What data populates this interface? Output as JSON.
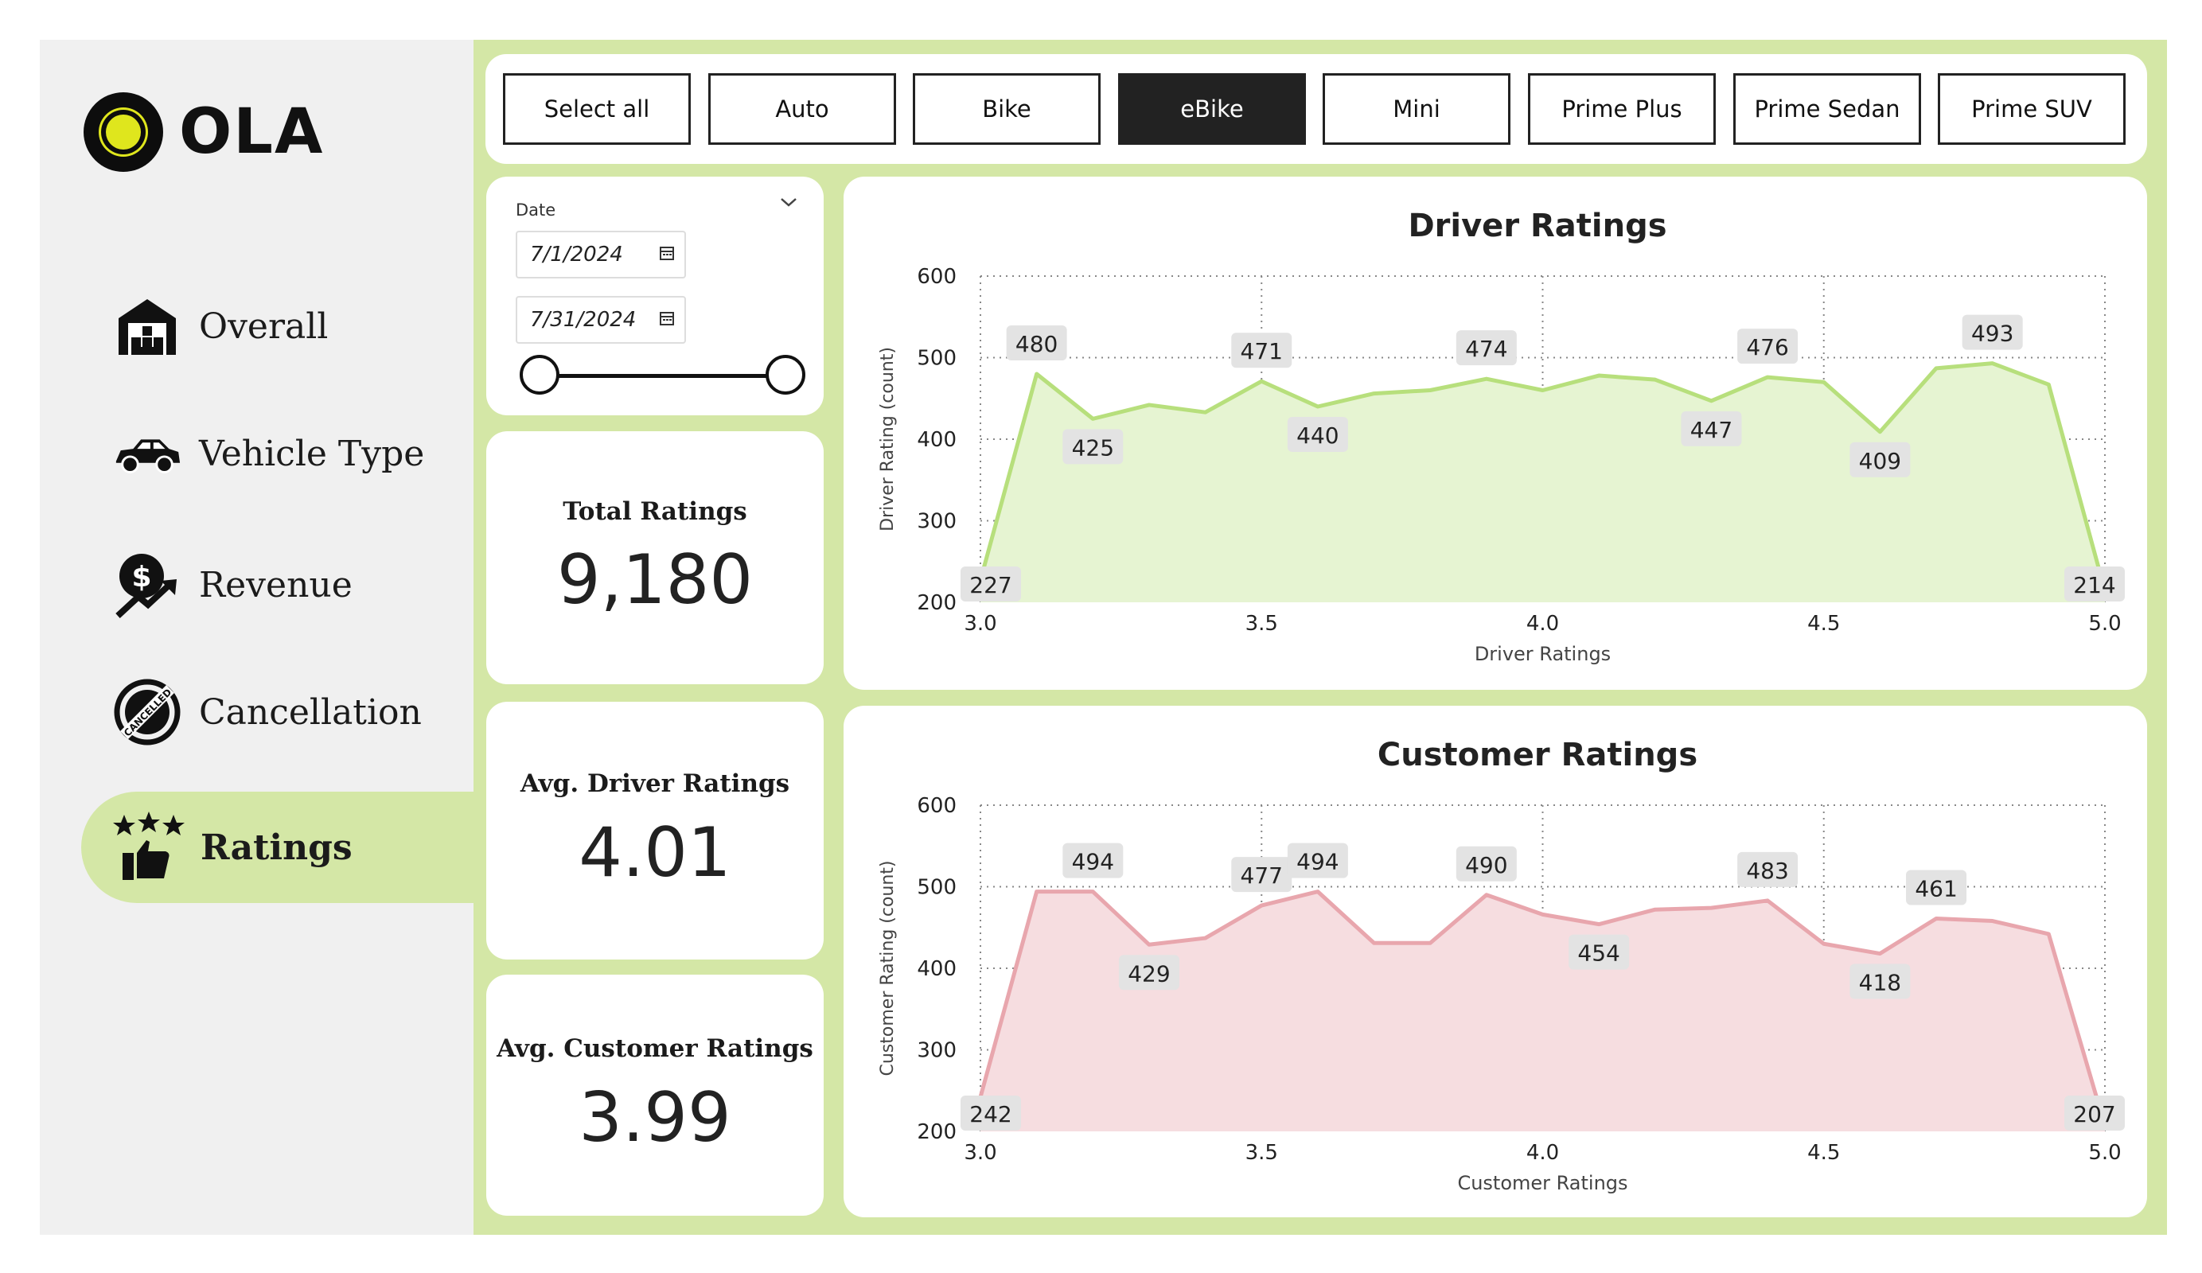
{
  "logo": {
    "text": "OLA"
  },
  "sidebar": {
    "items": [
      {
        "label": "Overall",
        "icon": "warehouse-icon"
      },
      {
        "label": "Vehicle Type",
        "icon": "car-icon"
      },
      {
        "label": "Revenue",
        "icon": "revenue-icon"
      },
      {
        "label": "Cancellation",
        "icon": "cancelled-stamp-icon"
      },
      {
        "label": "Ratings",
        "icon": "stars-thumbs-up-icon",
        "active": true
      }
    ]
  },
  "filters": {
    "vehicle_types": [
      {
        "label": "Select all",
        "selected": false
      },
      {
        "label": "Auto",
        "selected": false
      },
      {
        "label": "Bike",
        "selected": false
      },
      {
        "label": "eBike",
        "selected": true
      },
      {
        "label": "Mini",
        "selected": false
      },
      {
        "label": "Prime Plus",
        "selected": false
      },
      {
        "label": "Prime Sedan",
        "selected": false
      },
      {
        "label": "Prime SUV",
        "selected": false
      }
    ],
    "date": {
      "label": "Date",
      "start": "7/1/2024",
      "end": "7/31/2024"
    }
  },
  "cards": {
    "total_ratings": {
      "title": "Total Ratings",
      "value": "9,180"
    },
    "avg_driver": {
      "title": "Avg. Driver Ratings",
      "value": "4.01"
    },
    "avg_customer": {
      "title": "Avg. Customer Ratings",
      "value": "3.99"
    }
  },
  "colors": {
    "accent": "#d4e7a6",
    "driver_line": "#b7df7c",
    "driver_fill": "#e6f4d2",
    "customer_line": "#e8a6ad",
    "customer_fill": "#f6dde0"
  },
  "chart_data": [
    {
      "type": "area",
      "title": "Driver Ratings",
      "xlabel": "Driver Ratings",
      "ylabel": "Driver Rating (count)",
      "xlim": [
        3.0,
        5.0
      ],
      "ylim": [
        200,
        600
      ],
      "xticks": [
        "3.0",
        "3.5",
        "4.0",
        "4.5",
        "5.0"
      ],
      "yticks": [
        "200",
        "300",
        "400",
        "500",
        "600"
      ],
      "grid": true,
      "x": [
        3.0,
        3.1,
        3.2,
        3.3,
        3.4,
        3.5,
        3.6,
        3.7,
        3.8,
        3.9,
        4.0,
        4.1,
        4.2,
        4.3,
        4.4,
        4.5,
        4.6,
        4.7,
        4.8,
        4.9,
        5.0
      ],
      "y": [
        227,
        480,
        425,
        442,
        433,
        471,
        440,
        456,
        460,
        474,
        460,
        478,
        473,
        447,
        476,
        470,
        409,
        487,
        493,
        467,
        214
      ],
      "labels": [
        {
          "x": 3.0,
          "y": 227,
          "text": "227"
        },
        {
          "x": 3.1,
          "y": 480,
          "text": "480"
        },
        {
          "x": 3.2,
          "y": 425,
          "text": "425"
        },
        {
          "x": 3.5,
          "y": 471,
          "text": "471"
        },
        {
          "x": 3.6,
          "y": 440,
          "text": "440"
        },
        {
          "x": 3.9,
          "y": 474,
          "text": "474"
        },
        {
          "x": 4.3,
          "y": 447,
          "text": "447"
        },
        {
          "x": 4.4,
          "y": 476,
          "text": "476"
        },
        {
          "x": 4.6,
          "y": 409,
          "text": "409"
        },
        {
          "x": 4.8,
          "y": 493,
          "text": "493"
        },
        {
          "x": 5.0,
          "y": 214,
          "text": "214"
        }
      ]
    },
    {
      "type": "area",
      "title": "Customer Ratings",
      "xlabel": "Customer Ratings",
      "ylabel": "Customer Rating (count)",
      "xlim": [
        3.0,
        5.0
      ],
      "ylim": [
        200,
        600
      ],
      "xticks": [
        "3.0",
        "3.5",
        "4.0",
        "4.5",
        "5.0"
      ],
      "yticks": [
        "200",
        "300",
        "400",
        "500",
        "600"
      ],
      "grid": true,
      "x": [
        3.0,
        3.1,
        3.2,
        3.3,
        3.4,
        3.5,
        3.6,
        3.7,
        3.8,
        3.9,
        4.0,
        4.1,
        4.2,
        4.3,
        4.4,
        4.5,
        4.6,
        4.7,
        4.8,
        4.9,
        5.0
      ],
      "y": [
        242,
        494,
        494,
        429,
        437,
        477,
        494,
        431,
        431,
        490,
        466,
        454,
        472,
        474,
        483,
        430,
        418,
        461,
        458,
        442,
        207
      ],
      "labels": [
        {
          "x": 3.0,
          "y": 242,
          "text": "242"
        },
        {
          "x": 3.2,
          "y": 494,
          "text": "494"
        },
        {
          "x": 3.3,
          "y": 429,
          "text": "429"
        },
        {
          "x": 3.5,
          "y": 477,
          "text": "477"
        },
        {
          "x": 3.6,
          "y": 494,
          "text": "494"
        },
        {
          "x": 3.9,
          "y": 490,
          "text": "490"
        },
        {
          "x": 4.1,
          "y": 454,
          "text": "454"
        },
        {
          "x": 4.4,
          "y": 483,
          "text": "483"
        },
        {
          "x": 4.6,
          "y": 418,
          "text": "418"
        },
        {
          "x": 4.7,
          "y": 461,
          "text": "461"
        },
        {
          "x": 5.0,
          "y": 207,
          "text": "207"
        }
      ]
    }
  ]
}
